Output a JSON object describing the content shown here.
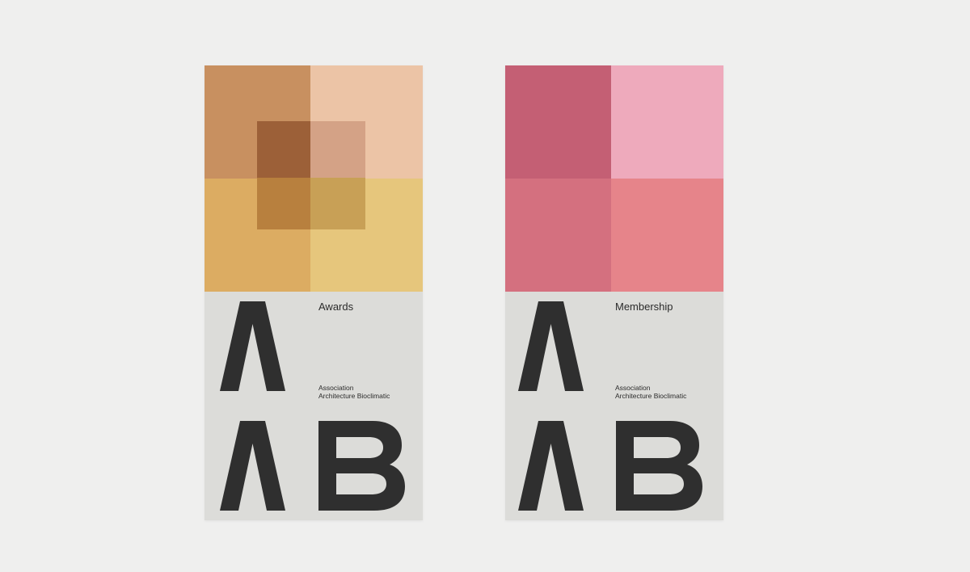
{
  "cards": [
    {
      "title": "Awards",
      "org_line1": "Association",
      "org_line2": "Architecture Bioclimatic",
      "mark_letters": "AB",
      "colors": {
        "top_left": "#c89060",
        "top_right": "#ecc4a6",
        "bottom_left": "#dcac62",
        "bottom_right": "#e6c67c",
        "overlay_top_left": "#9c6038",
        "overlay_top_right": "#d4a286",
        "overlay_bottom_left": "#b8803e",
        "overlay_bottom_right": "#c8a056"
      }
    },
    {
      "title": "Membership",
      "org_line1": "Association",
      "org_line2": "Architecture Bioclimatic",
      "mark_letters": "AB",
      "colors": {
        "top_left": "#c45f74",
        "top_right": "#eeaabc",
        "bottom_left": "#d4707f",
        "bottom_right": "#e6848a"
      }
    }
  ],
  "theme": {
    "background": "#efefee",
    "card_lower": "#dcdcd9",
    "ink": "#2f2f2f"
  }
}
